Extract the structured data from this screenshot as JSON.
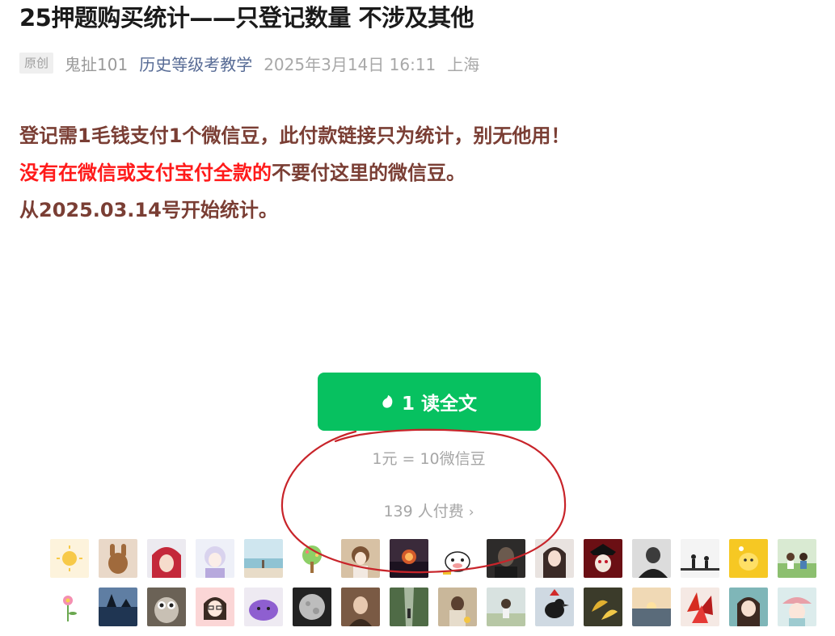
{
  "article": {
    "title": "25押题购买统计——只登记数量 不涉及其他",
    "badge": "原创",
    "author": "鬼扯101",
    "account": "历史等级考教学",
    "date": "2025年3月14日 16:11",
    "location": "上海"
  },
  "body": {
    "line1": "登记需1毛钱支付1个微信豆，此付款链接只为统计，别无他用！",
    "line2_red": "没有在微信或支付宝付全款的",
    "line2_rest": "不要付这里的微信豆。",
    "line3": "从2025.03.14号开始统计。"
  },
  "paywall": {
    "button_label": "1 读全文",
    "rate": "1元 = 10微信豆",
    "payers": "139 人付费",
    "accent": "#07c160"
  },
  "avatars": [
    "sun",
    "bunny",
    "anime-boy",
    "anime-girl",
    "beach",
    "tree",
    "doll",
    "sunset-tree",
    "cow-cartoon",
    "dark-portrait",
    "girl-selfie",
    "vampire",
    "man-bw",
    "chess",
    "yellow-cat",
    "couple-drawing",
    "flower",
    "sea-rocks",
    "owl",
    "cartoon-glasses",
    "purple-toy",
    "moon",
    "girl-portrait",
    "forest-walk",
    "girl-back",
    "girl-field",
    "crow",
    "leaves",
    "sea-sunset",
    "red-maple",
    "girl-teal",
    "hat-girl"
  ]
}
